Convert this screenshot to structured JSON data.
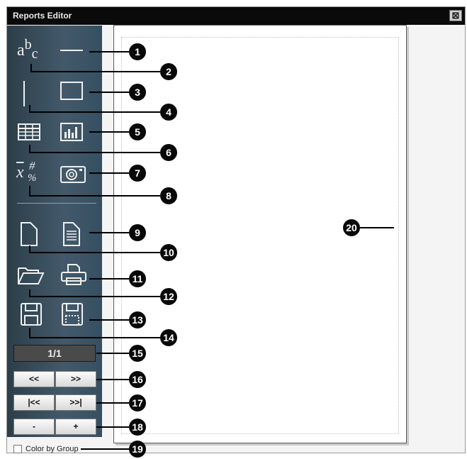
{
  "window": {
    "title": "Reports Editor",
    "close_glyph": "⊠"
  },
  "icons": {
    "text": {
      "a": "a",
      "b": "b",
      "c": "c"
    },
    "stat": {
      "x": "x",
      "sup": "#",
      "sub": "%"
    },
    "names": [
      "text-tool-icon",
      "line-tool-icon",
      "vertical-line-tool-icon",
      "rectangle-tool-icon",
      "table-tool-icon",
      "chart-tool-icon",
      "statistics-tool-icon",
      "image-tool-icon",
      "new-page-icon",
      "page-template-icon",
      "open-folder-icon",
      "print-icon",
      "save-icon",
      "save-as-icon"
    ]
  },
  "pager": {
    "page_display": "1/1"
  },
  "buttons": {
    "prev": "<<",
    "next": ">>",
    "first": "|<<",
    "last": ">>|",
    "zoom_out": "-",
    "zoom_in": "+"
  },
  "options": {
    "color_by_group_label": "Color by Group",
    "color_by_group_checked": false
  },
  "callouts": [
    "1",
    "2",
    "3",
    "4",
    "5",
    "6",
    "7",
    "8",
    "9",
    "10",
    "11",
    "12",
    "13",
    "14",
    "15",
    "16",
    "17",
    "18",
    "19",
    "20"
  ]
}
